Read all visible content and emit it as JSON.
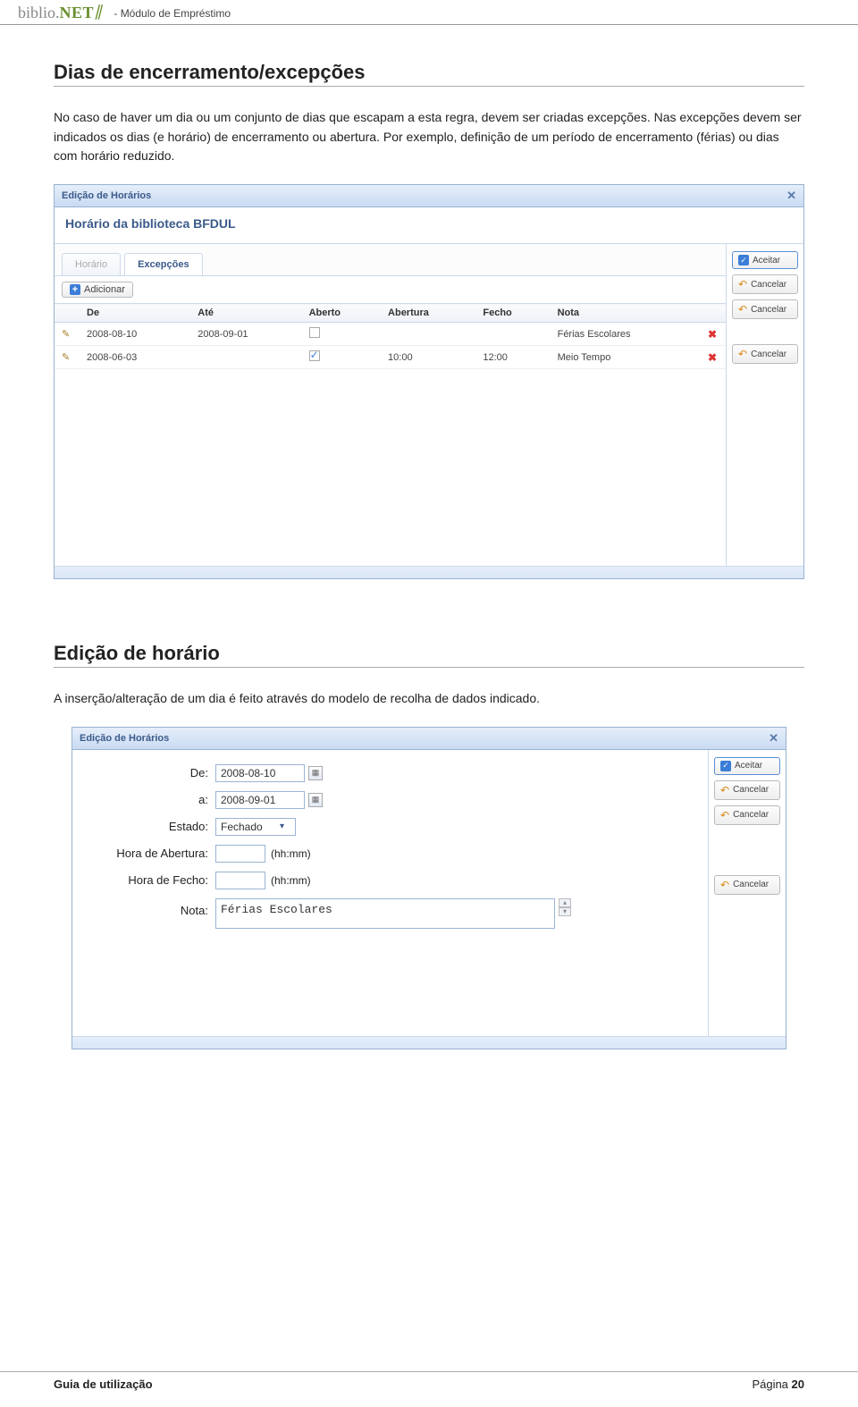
{
  "header": {
    "logo_biblio": "biblio.",
    "logo_net": "NET",
    "module": "- Módulo de Empréstimo"
  },
  "section1": {
    "title": "Dias de encerramento/excepções",
    "paragraph": "No caso de haver um dia ou um conjunto de dias que escapam a esta regra, devem ser criadas excepções. Nas excepções devem ser indicados os dias (e horário) de encerramento ou abertura. Por exemplo, definição de um período de encerramento (férias) ou dias com horário reduzido."
  },
  "panel1": {
    "titlebar": "Edição de Horários",
    "subtitle": "Horário da biblioteca BFDUL",
    "tabs": {
      "horario": "Horário",
      "excepcoes": "Excepções"
    },
    "add_btn": "Adicionar",
    "columns": {
      "de": "De",
      "ate": "Até",
      "aberto": "Aberto",
      "abertura": "Abertura",
      "fecho": "Fecho",
      "nota": "Nota"
    },
    "rows": [
      {
        "de": "2008-08-10",
        "ate": "2008-09-01",
        "checked": false,
        "abertura": "",
        "fecho": "",
        "nota": "Férias Escolares"
      },
      {
        "de": "2008-06-03",
        "ate": "",
        "checked": true,
        "abertura": "10:00",
        "fecho": "12:00",
        "nota": "Meio Tempo"
      }
    ],
    "side": {
      "aceitar": "Aceitar",
      "cancelar": "Cancelar"
    }
  },
  "section2": {
    "title": "Edição de horário",
    "paragraph": "A inserção/alteração de um dia é feito através do modelo de recolha de dados indicado."
  },
  "panel2": {
    "titlebar": "Edição de Horários",
    "labels": {
      "de": "De:",
      "a": "a:",
      "estado": "Estado:",
      "hora_abertura": "Hora de Abertura:",
      "hora_fecho": "Hora de Fecho:",
      "nota": "Nota:",
      "hhmm": "(hh:mm)"
    },
    "values": {
      "de": "2008-08-10",
      "a": "2008-09-01",
      "estado": "Fechado",
      "nota": "Férias Escolares"
    },
    "side": {
      "aceitar": "Aceitar",
      "cancelar": "Cancelar"
    }
  },
  "footer": {
    "left": "Guia de utilização",
    "right_prefix": "Página ",
    "page_no": "20"
  }
}
